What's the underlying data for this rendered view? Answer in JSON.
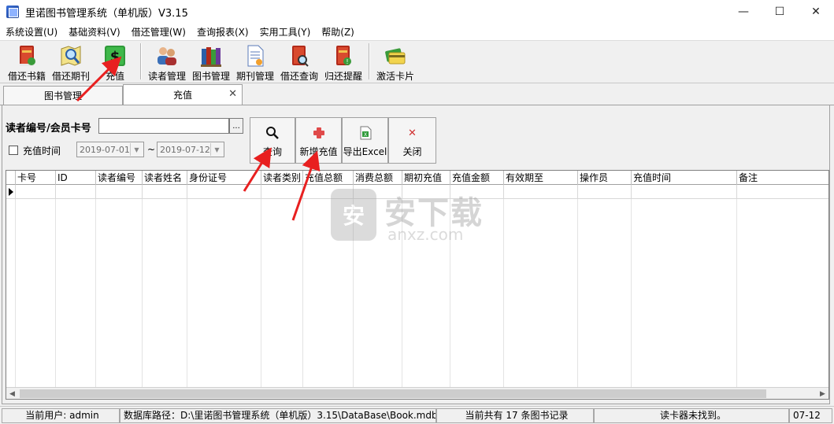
{
  "window": {
    "title": "里诺图书管理系统（单机版）V3.15",
    "minimize_glyph": "—",
    "maximize_glyph": "☐",
    "close_glyph": "✕"
  },
  "menu": [
    "系统设置(U)",
    "基础资料(V)",
    "借还管理(W)",
    "查询报表(X)",
    "实用工具(Y)",
    "帮助(Z)"
  ],
  "toolbar": {
    "borrow_return_books": "借还书籍",
    "borrow_return_periodicals": "借还期刊",
    "recharge": "充值",
    "reader_mgmt": "读者管理",
    "book_mgmt": "图书管理",
    "periodical_mgmt": "期刊管理",
    "borrow_query": "借还查询",
    "return_reminder": "归还提醒",
    "activate_card": "激活卡片"
  },
  "tabs": {
    "book_mgmt": "图书管理",
    "recharge": "充值",
    "close_glyph": "✕"
  },
  "form": {
    "card_label": "读者编号/会员卡号",
    "ellipsis": "...",
    "recharge_time_label": "充值时间",
    "date_from": "2019-07-01",
    "date_to": "2019-07-12",
    "tilde": "~"
  },
  "actions": {
    "query": "查询",
    "add_recharge": "新增充值",
    "export_excel": "导出Excel",
    "close": "关闭",
    "close_glyph": "✕"
  },
  "grid": {
    "columns": [
      "卡号",
      "ID",
      "读者编号",
      "读者姓名",
      "身份证号",
      "读者类别",
      "充值总额",
      "消费总额",
      "期初充值",
      "充值金额",
      "有效期至",
      "操作员",
      "充值时间",
      "备注"
    ]
  },
  "watermark": {
    "logo": "安",
    "text": "安下载",
    "sub": "anxz.com"
  },
  "status": {
    "user": "当前用户: admin",
    "db_path": "数据库路径：D:\\里诺图书管理系统（单机版）3.15\\DataBase\\Book.mdb",
    "record_count": "当前共有 17 条图书记录",
    "card_reader": "读卡器未找到。",
    "date": "07-12"
  }
}
